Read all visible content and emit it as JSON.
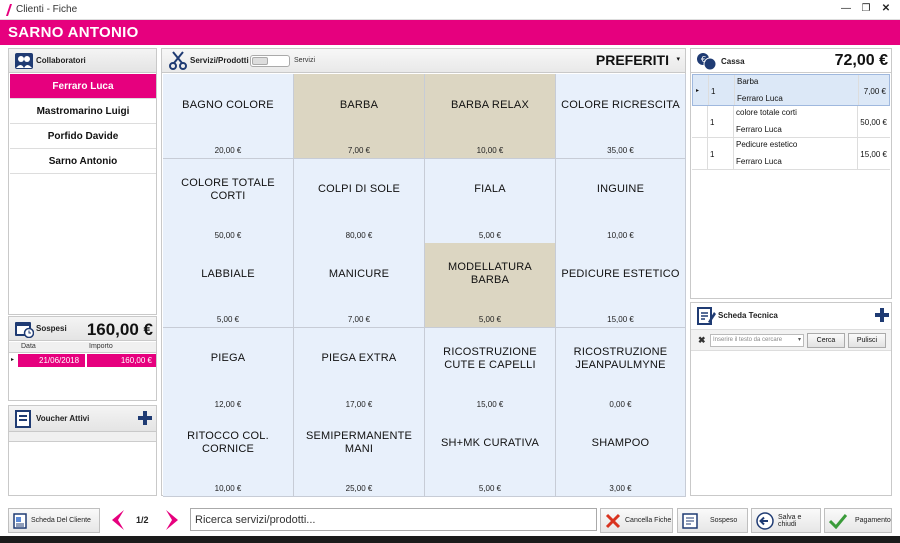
{
  "window": {
    "title": "Clienti - Fiche"
  },
  "client": {
    "name": "SARNO ANTONIO"
  },
  "collaborators": {
    "title": "Collaboratori",
    "items": [
      {
        "label": "Ferraro Luca",
        "active": true
      },
      {
        "label": "Mastromarino Luigi",
        "active": false
      },
      {
        "label": "Porfido Davide",
        "active": false
      },
      {
        "label": "Sarno Antonio",
        "active": false
      }
    ]
  },
  "sospesi": {
    "title": "Sospesi",
    "amount": "160,00 €",
    "columns": [
      "Data",
      "Importo"
    ],
    "rows": [
      {
        "date": "21/06/2018",
        "amount": "160,00 €"
      }
    ]
  },
  "vouchers": {
    "title": "Voucher Attivi"
  },
  "services": {
    "title": "Servizi/Prodotti",
    "toggle_label": "Servizi",
    "category": "PREFERITI",
    "tiles": [
      {
        "name": "BAGNO COLORE",
        "price": "20,00 €",
        "color": "blue"
      },
      {
        "name": "BARBA",
        "price": "7,00 €",
        "color": "beige"
      },
      {
        "name": "BARBA RELAX",
        "price": "10,00 €",
        "color": "beige"
      },
      {
        "name": "COLORE RICRESCITA",
        "price": "35,00 €",
        "color": "blue"
      },
      {
        "name": "COLORE TOTALE CORTI",
        "price": "50,00 €",
        "color": "blue"
      },
      {
        "name": "COLPI DI SOLE",
        "price": "80,00 €",
        "color": "blue"
      },
      {
        "name": "FIALA",
        "price": "5,00 €",
        "color": "blue"
      },
      {
        "name": "INGUINE",
        "price": "10,00 €",
        "color": "blue"
      },
      {
        "name": "LABBIALE",
        "price": "5,00 €",
        "color": "blue"
      },
      {
        "name": "MANICURE",
        "price": "7,00 €",
        "color": "blue"
      },
      {
        "name": "MODELLATURA BARBA",
        "price": "5,00 €",
        "color": "beige"
      },
      {
        "name": "PEDICURE ESTETICO",
        "price": "15,00 €",
        "color": "blue"
      },
      {
        "name": "PIEGA",
        "price": "12,00 €",
        "color": "blue"
      },
      {
        "name": "PIEGA EXTRA",
        "price": "17,00 €",
        "color": "blue"
      },
      {
        "name": "RICOSTRUZIONE CUTE E CAPELLI",
        "price": "15,00 €",
        "color": "blue"
      },
      {
        "name": "RICOSTRUZIONE JEANPAULMYNE",
        "price": "0,00 €",
        "color": "blue"
      },
      {
        "name": "RITOCCO COL. CORNICE",
        "price": "10,00 €",
        "color": "blue"
      },
      {
        "name": "SEMIPERMANENTE MANI",
        "price": "25,00 €",
        "color": "blue"
      },
      {
        "name": "SH+MK CURATIVA",
        "price": "5,00 €",
        "color": "blue"
      },
      {
        "name": "SHAMPOO",
        "price": "3,00 €",
        "color": "blue"
      }
    ]
  },
  "cassa": {
    "title": "Cassa",
    "total": "72,00 €",
    "rows": [
      {
        "qty": "1",
        "description": "Barba",
        "operator": "Ferraro Luca",
        "amount": "7,00 €",
        "selected": true
      },
      {
        "qty": "1",
        "description": "colore totale corti",
        "operator": "Ferraro Luca",
        "amount": "50,00 €",
        "selected": false
      },
      {
        "qty": "1",
        "description": "Pedicure estetico",
        "operator": "Ferraro Luca",
        "amount": "15,00 €",
        "selected": false
      }
    ]
  },
  "scheda_tecnica": {
    "title": "Scheda Tecnica",
    "search_placeholder": "Inserire il testo da cercare",
    "search_button": "Cerca",
    "clear_button": "Pulisci"
  },
  "toolbar": {
    "scheda_cliente": "Scheda Del Cliente",
    "page": "1/2",
    "search_placeholder": "Ricerca servizi/prodotti...",
    "cancella": "Cancella Fiche",
    "sospeso": "Sospeso",
    "salva": "Salva e chiudi",
    "pagamento": "Pagamento"
  },
  "colors": {
    "accent": "#e6007e",
    "tile_blue": "#e8f0fb",
    "tile_beige": "#dcd6c2",
    "icon_blue": "#1f3b73"
  }
}
